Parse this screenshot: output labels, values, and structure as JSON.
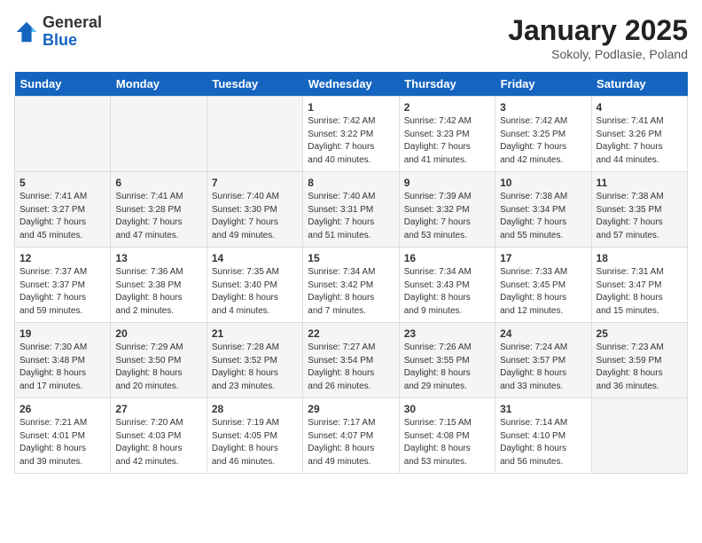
{
  "header": {
    "logo_general": "General",
    "logo_blue": "Blue",
    "month_title": "January 2025",
    "location": "Sokoly, Podlasie, Poland"
  },
  "days_of_week": [
    "Sunday",
    "Monday",
    "Tuesday",
    "Wednesday",
    "Thursday",
    "Friday",
    "Saturday"
  ],
  "weeks": [
    [
      {
        "day": "",
        "text": ""
      },
      {
        "day": "",
        "text": ""
      },
      {
        "day": "",
        "text": ""
      },
      {
        "day": "1",
        "text": "Sunrise: 7:42 AM\nSunset: 3:22 PM\nDaylight: 7 hours\nand 40 minutes."
      },
      {
        "day": "2",
        "text": "Sunrise: 7:42 AM\nSunset: 3:23 PM\nDaylight: 7 hours\nand 41 minutes."
      },
      {
        "day": "3",
        "text": "Sunrise: 7:42 AM\nSunset: 3:25 PM\nDaylight: 7 hours\nand 42 minutes."
      },
      {
        "day": "4",
        "text": "Sunrise: 7:41 AM\nSunset: 3:26 PM\nDaylight: 7 hours\nand 44 minutes."
      }
    ],
    [
      {
        "day": "5",
        "text": "Sunrise: 7:41 AM\nSunset: 3:27 PM\nDaylight: 7 hours\nand 45 minutes."
      },
      {
        "day": "6",
        "text": "Sunrise: 7:41 AM\nSunset: 3:28 PM\nDaylight: 7 hours\nand 47 minutes."
      },
      {
        "day": "7",
        "text": "Sunrise: 7:40 AM\nSunset: 3:30 PM\nDaylight: 7 hours\nand 49 minutes."
      },
      {
        "day": "8",
        "text": "Sunrise: 7:40 AM\nSunset: 3:31 PM\nDaylight: 7 hours\nand 51 minutes."
      },
      {
        "day": "9",
        "text": "Sunrise: 7:39 AM\nSunset: 3:32 PM\nDaylight: 7 hours\nand 53 minutes."
      },
      {
        "day": "10",
        "text": "Sunrise: 7:38 AM\nSunset: 3:34 PM\nDaylight: 7 hours\nand 55 minutes."
      },
      {
        "day": "11",
        "text": "Sunrise: 7:38 AM\nSunset: 3:35 PM\nDaylight: 7 hours\nand 57 minutes."
      }
    ],
    [
      {
        "day": "12",
        "text": "Sunrise: 7:37 AM\nSunset: 3:37 PM\nDaylight: 7 hours\nand 59 minutes."
      },
      {
        "day": "13",
        "text": "Sunrise: 7:36 AM\nSunset: 3:38 PM\nDaylight: 8 hours\nand 2 minutes."
      },
      {
        "day": "14",
        "text": "Sunrise: 7:35 AM\nSunset: 3:40 PM\nDaylight: 8 hours\nand 4 minutes."
      },
      {
        "day": "15",
        "text": "Sunrise: 7:34 AM\nSunset: 3:42 PM\nDaylight: 8 hours\nand 7 minutes."
      },
      {
        "day": "16",
        "text": "Sunrise: 7:34 AM\nSunset: 3:43 PM\nDaylight: 8 hours\nand 9 minutes."
      },
      {
        "day": "17",
        "text": "Sunrise: 7:33 AM\nSunset: 3:45 PM\nDaylight: 8 hours\nand 12 minutes."
      },
      {
        "day": "18",
        "text": "Sunrise: 7:31 AM\nSunset: 3:47 PM\nDaylight: 8 hours\nand 15 minutes."
      }
    ],
    [
      {
        "day": "19",
        "text": "Sunrise: 7:30 AM\nSunset: 3:48 PM\nDaylight: 8 hours\nand 17 minutes."
      },
      {
        "day": "20",
        "text": "Sunrise: 7:29 AM\nSunset: 3:50 PM\nDaylight: 8 hours\nand 20 minutes."
      },
      {
        "day": "21",
        "text": "Sunrise: 7:28 AM\nSunset: 3:52 PM\nDaylight: 8 hours\nand 23 minutes."
      },
      {
        "day": "22",
        "text": "Sunrise: 7:27 AM\nSunset: 3:54 PM\nDaylight: 8 hours\nand 26 minutes."
      },
      {
        "day": "23",
        "text": "Sunrise: 7:26 AM\nSunset: 3:55 PM\nDaylight: 8 hours\nand 29 minutes."
      },
      {
        "day": "24",
        "text": "Sunrise: 7:24 AM\nSunset: 3:57 PM\nDaylight: 8 hours\nand 33 minutes."
      },
      {
        "day": "25",
        "text": "Sunrise: 7:23 AM\nSunset: 3:59 PM\nDaylight: 8 hours\nand 36 minutes."
      }
    ],
    [
      {
        "day": "26",
        "text": "Sunrise: 7:21 AM\nSunset: 4:01 PM\nDaylight: 8 hours\nand 39 minutes."
      },
      {
        "day": "27",
        "text": "Sunrise: 7:20 AM\nSunset: 4:03 PM\nDaylight: 8 hours\nand 42 minutes."
      },
      {
        "day": "28",
        "text": "Sunrise: 7:19 AM\nSunset: 4:05 PM\nDaylight: 8 hours\nand 46 minutes."
      },
      {
        "day": "29",
        "text": "Sunrise: 7:17 AM\nSunset: 4:07 PM\nDaylight: 8 hours\nand 49 minutes."
      },
      {
        "day": "30",
        "text": "Sunrise: 7:15 AM\nSunset: 4:08 PM\nDaylight: 8 hours\nand 53 minutes."
      },
      {
        "day": "31",
        "text": "Sunrise: 7:14 AM\nSunset: 4:10 PM\nDaylight: 8 hours\nand 56 minutes."
      },
      {
        "day": "",
        "text": ""
      }
    ]
  ]
}
